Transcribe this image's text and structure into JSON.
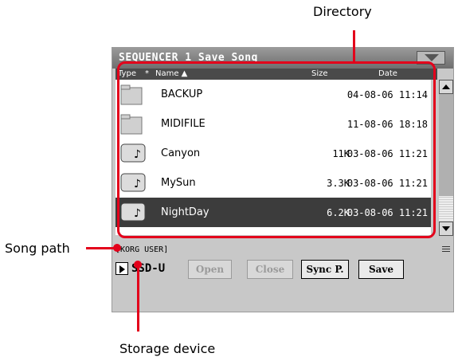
{
  "callouts": {
    "directory": "Directory",
    "song_path": "Song path",
    "storage_device": "Storage device"
  },
  "window": {
    "title": "SEQUENCER 1  Save Song"
  },
  "list": {
    "headers": {
      "type": "Type",
      "sort_marker": "*",
      "name": "Name ▲",
      "size": "Size",
      "date": "Date"
    },
    "items": [
      {
        "name": "BACKUP",
        "size": "",
        "date": "04-08-06 11:14",
        "icon": "folder-icon",
        "selected": false
      },
      {
        "name": "MIDIFILE",
        "size": "",
        "date": "11-08-06 18:18",
        "icon": "folder-icon",
        "selected": false
      },
      {
        "name": "Canyon",
        "size": "11K",
        "date": "03-08-06 11:21",
        "icon": "midi-song-icon",
        "selected": false
      },
      {
        "name": "MySun",
        "size": "3.3K",
        "date": "03-08-06 11:21",
        "icon": "midi-song-icon",
        "selected": false
      },
      {
        "name": "NightDay",
        "size": "6.2K",
        "date": "03-08-06 11:21",
        "icon": "midi-song-icon",
        "selected": true
      }
    ]
  },
  "path": {
    "text": "[KORG USER]"
  },
  "device": {
    "name": "SSD-U"
  },
  "buttons": {
    "open": "Open",
    "close": "Close",
    "sync": "Sync P.",
    "save": "Save"
  },
  "colors": {
    "callout": "#e3001b",
    "selection": "#3c3c3c",
    "titlebar": "#7a7a7a"
  }
}
